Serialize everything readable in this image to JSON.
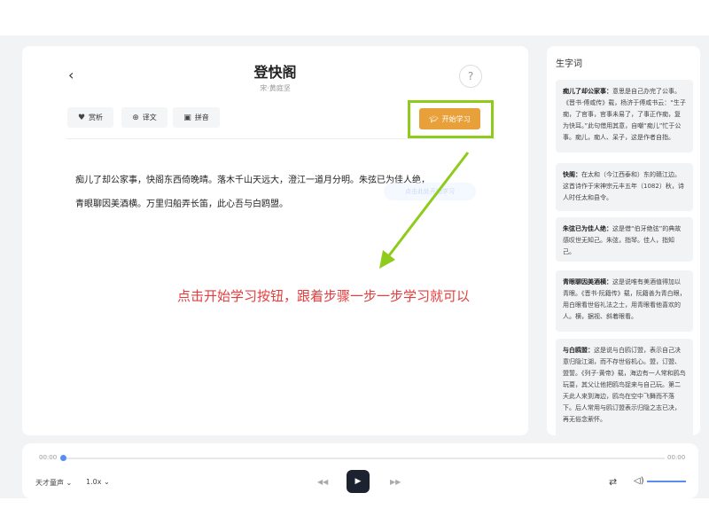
{
  "poem": {
    "title": "登快阁",
    "author": "宋·黄庭坚",
    "help_label": "?",
    "back_label": "‹",
    "lines": [
      "痴儿了却公家事，快阁东西倚晚晴。落木千山天远大，澄江一道月分明。朱弦已为佳人绝，",
      "青眼聊因美酒横。万里归船弄长笛，此心吾与白鸥盟。"
    ]
  },
  "tabs": [
    {
      "label": "赏析",
      "icon": "heart-icon"
    },
    {
      "label": "译文",
      "icon": "globe-icon"
    },
    {
      "label": "拼音",
      "icon": "pinyin-card-icon"
    }
  ],
  "start_button": {
    "label": "开始学习",
    "icon": "graduation-cap-icon"
  },
  "hint_chip": "点击此处开始学习",
  "annotation_text": "点击开始学习按钮，跟着步骤一步一步学习就可以",
  "sidebar": {
    "title": "生字词",
    "items": [
      {
        "term": "痴儿了却公家事：",
        "text": "意思是自己办完了公事。《晋书·傅咸传》载，杨济于傅咸书云：“生子痴，了官事，官事未易了，了事正作痴，复为快耳。”此句借用其意，自嘲“痴儿”忙于公事。痴儿，痴人、呆子，这是作者自指。"
      },
      {
        "term": "快阁：",
        "text": "在太和（今江西泰和）东的赣江边。这首诗作于宋神宗元丰五年（1082）秋，诗人时任太和县令。"
      },
      {
        "term": "朱弦已为佳人绝：",
        "text": "这是借“伯牙绝弦”的典故感叹世无知己。朱弦，指琴。佳人，指知己。"
      },
      {
        "term": "青眼聊因美酒横：",
        "text": "这是说唯有美酒值得加以青眼。《晋书·阮籍传》载，阮籍善为青白眼，用白眼看世俗礼法之士，用青眼看他喜欢的人。横，据视、斜着眼看。"
      },
      {
        "term": "与白鸥盟：",
        "text": "这是说与白鸥订盟，表示自己决意归隐江湖，而不存世俗机心。盟，订盟、盟誓。《列子·黄帝》载，海边有一人常和鸥鸟玩耍，其父让他把鸥鸟捉来与自己玩。第二天此人来到海边，鸥鸟在空中飞舞而不落下。后人常用与鸥订盟表示归隐之志已决，再无俗念萦怀。"
      }
    ]
  },
  "player": {
    "current_time": "00:00",
    "total_time": "00:00",
    "progress": 0,
    "voice": "天才童声",
    "speed": "1.0x",
    "prev_icon": "rewind-icon",
    "play_icon": "play-icon",
    "next_icon": "fast-forward-icon",
    "loop_icon": "loop-icon",
    "volume_icon": "volume-icon",
    "volume": 1.0
  },
  "colors": {
    "accent": "#e8a13a",
    "highlight": "#8ecb1b",
    "annotation": "#e53d3d",
    "progress": "#5b8cf0",
    "play_button": "#1c2230"
  }
}
